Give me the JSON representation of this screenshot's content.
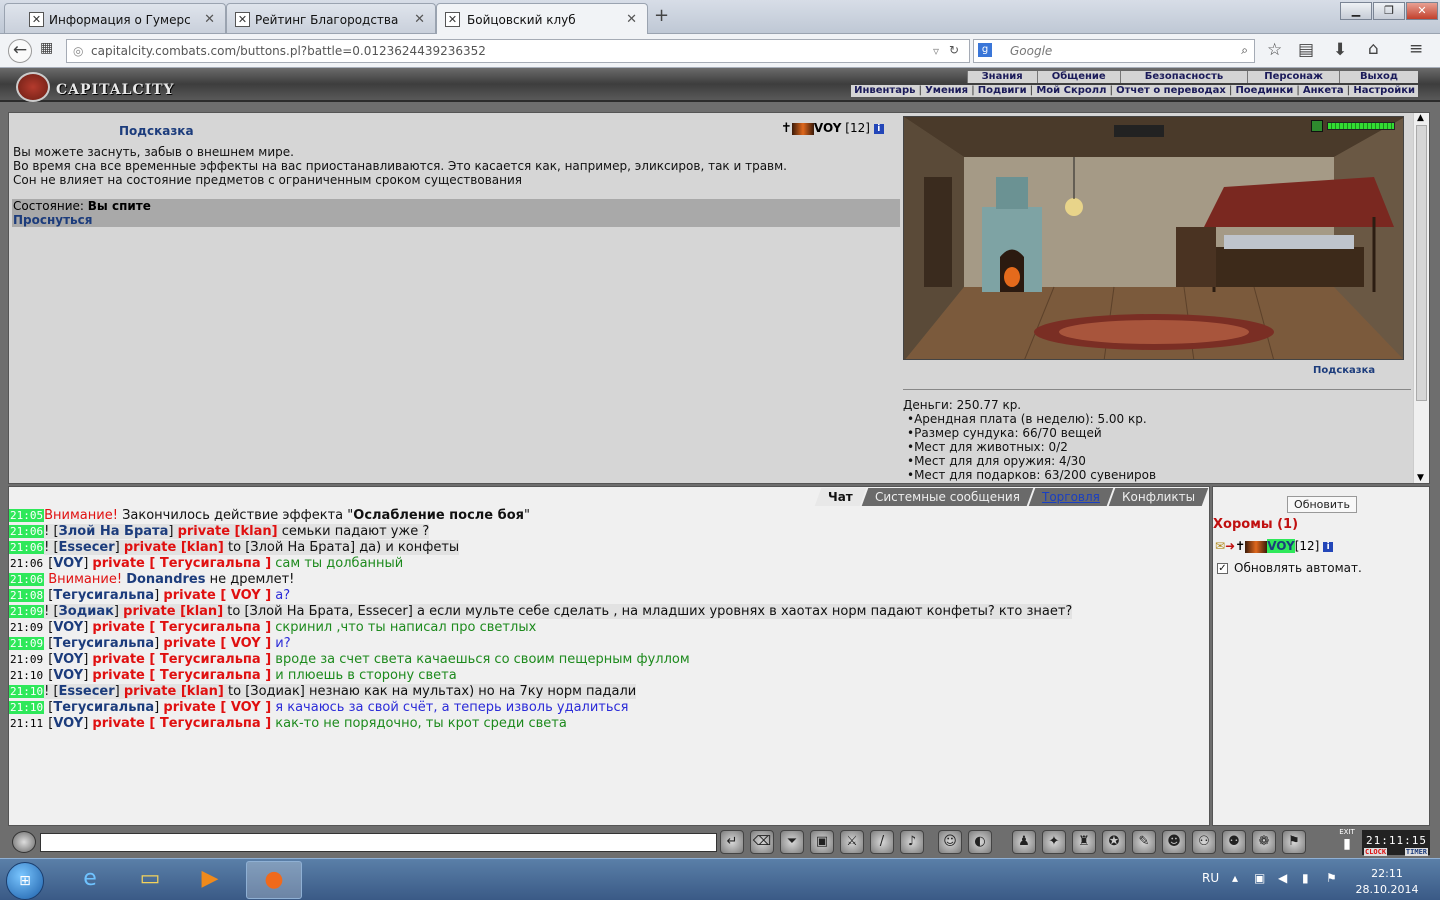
{
  "browser": {
    "tabs": [
      {
        "label": "Информация о Гумерс"
      },
      {
        "label": "Рейтинг Благородства"
      },
      {
        "label": "Бойцовский клуб"
      }
    ],
    "url": "capitalcity.combats.com/buttons.pl?battle=0.0123624439236352",
    "search_placeholder": "Google"
  },
  "game_header": {
    "logo": "CAPITALCITY",
    "top_menu": [
      "Знания",
      "Общение",
      "Безопасность",
      "Персонаж",
      "Выход"
    ],
    "sub_menu": [
      "Инвентарь",
      "Умения",
      "Подвиги",
      "Мой Скролл",
      "Отчет о переводах",
      "Поединки",
      "Анкета",
      "Настройки"
    ]
  },
  "room": {
    "hint_link": "Подсказка",
    "user": {
      "name": "VOY",
      "level": "[12]",
      "info_icon": "i"
    },
    "description": [
      "Вы можете заснуть, забыв о внешнем мире.",
      "Во время сна все временные эффекты на вас приостанавливаются. Это касается как, например, эликсиров, так и травм.",
      "Сон не влияет на состояние предметов с ограниченным сроком существования"
    ],
    "state_label": "Состояние:",
    "state_value": "Вы спите",
    "wake_link": "Проснуться",
    "hint_link_2": "Подсказка",
    "money": "Деньги: 250.77 кр.",
    "stats": [
      "Арендная плата (в неделю): 5.00 кр.",
      "Размер сундука: 66/70 вещей",
      "Мест для животных: 0/2",
      "Мест для для оружия: 4/30",
      "Мест для подарков: 63/200 сувениров"
    ]
  },
  "chat": {
    "tabs": [
      "Чат",
      "Системные сообщения",
      "Торговля",
      "Конфликты"
    ],
    "lines": [
      {
        "time": "21:05",
        "hl": true,
        "parts": [
          {
            "t": "Внимание! ",
            "c": "red"
          },
          {
            "t": "Закончилось действие эффекта \"",
            "c": "blk"
          },
          {
            "t": "Ослабление после боя",
            "c": "blkb"
          },
          {
            "t": "\"",
            "c": "blk"
          }
        ]
      },
      {
        "time": "21:06",
        "hl": true,
        "parts": [
          {
            "t": "! [",
            "c": "blk"
          },
          {
            "t": "Злой На Брата",
            "c": "nick"
          },
          {
            "t": "] ",
            "c": "blk"
          },
          {
            "t": "private [klan]",
            "c": "priv"
          },
          {
            "t": " семьки падают уже ?",
            "c": "blk"
          }
        ],
        "shade": true
      },
      {
        "time": "21:06",
        "hl": true,
        "parts": [
          {
            "t": "! [",
            "c": "blk"
          },
          {
            "t": "Essecer",
            "c": "nick"
          },
          {
            "t": "] ",
            "c": "blk"
          },
          {
            "t": "private [klan]",
            "c": "priv"
          },
          {
            "t": " to [Злой На Брата] да) и конфеты",
            "c": "blk"
          }
        ],
        "shade": true
      },
      {
        "time": "21:06",
        "hl": false,
        "parts": [
          {
            "t": " [",
            "c": "blk"
          },
          {
            "t": "VOY",
            "c": "nick"
          },
          {
            "t": "] ",
            "c": "blk"
          },
          {
            "t": "private [ Тегусигальпа ]",
            "c": "priv"
          },
          {
            "t": " сам ты долбанный",
            "c": "green"
          }
        ]
      },
      {
        "time": "21:06",
        "hl": true,
        "parts": [
          {
            "t": " Внимание! ",
            "c": "red"
          },
          {
            "t": "Donandres",
            "c": "nick"
          },
          {
            "t": " не дремлет!",
            "c": "blk"
          }
        ]
      },
      {
        "time": "21:08",
        "hl": true,
        "parts": [
          {
            "t": " [",
            "c": "blk"
          },
          {
            "t": "Тегусигальпа",
            "c": "nick"
          },
          {
            "t": "] ",
            "c": "blk"
          },
          {
            "t": "private [ VOY ]",
            "c": "priv"
          },
          {
            "t": " а?",
            "c": "blue"
          }
        ]
      },
      {
        "time": "21:09",
        "hl": true,
        "parts": [
          {
            "t": "! [",
            "c": "blk"
          },
          {
            "t": "Зодиак",
            "c": "nick"
          },
          {
            "t": "] ",
            "c": "blk"
          },
          {
            "t": "private [klan]",
            "c": "priv"
          },
          {
            "t": " to [Злой На Брата, Essecer] а если мульте себе сделать , на младших уровнях в хаотах норм падают конфеты? кто знает?",
            "c": "blk"
          }
        ],
        "shade": true
      },
      {
        "time": "21:09",
        "hl": false,
        "parts": [
          {
            "t": " [",
            "c": "blk"
          },
          {
            "t": "VOY",
            "c": "nick"
          },
          {
            "t": "] ",
            "c": "blk"
          },
          {
            "t": "private [ Тегусигальпа ]",
            "c": "priv"
          },
          {
            "t": " скринил ,что ты написал про светлых",
            "c": "green"
          }
        ]
      },
      {
        "time": "21:09",
        "hl": true,
        "parts": [
          {
            "t": " [",
            "c": "blk"
          },
          {
            "t": "Тегусигальпа",
            "c": "nick"
          },
          {
            "t": "] ",
            "c": "blk"
          },
          {
            "t": "private [ VOY ]",
            "c": "priv"
          },
          {
            "t": " и?",
            "c": "blue"
          }
        ]
      },
      {
        "time": "21:09",
        "hl": false,
        "parts": [
          {
            "t": " [",
            "c": "blk"
          },
          {
            "t": "VOY",
            "c": "nick"
          },
          {
            "t": "] ",
            "c": "blk"
          },
          {
            "t": "private [ Тегусигальпа ]",
            "c": "priv"
          },
          {
            "t": " вроде за счет света качаешься со своим пещерным фуллом",
            "c": "green"
          }
        ]
      },
      {
        "time": "21:10",
        "hl": false,
        "parts": [
          {
            "t": " [",
            "c": "blk"
          },
          {
            "t": "VOY",
            "c": "nick"
          },
          {
            "t": "] ",
            "c": "blk"
          },
          {
            "t": "private [ Тегусигальпа ]",
            "c": "priv"
          },
          {
            "t": " и плюешь в сторону света",
            "c": "green"
          }
        ]
      },
      {
        "time": "21:10",
        "hl": true,
        "parts": [
          {
            "t": "! [",
            "c": "blk"
          },
          {
            "t": "Essecer",
            "c": "nick"
          },
          {
            "t": "] ",
            "c": "blk"
          },
          {
            "t": "private [klan]",
            "c": "priv"
          },
          {
            "t": " to [Зодиак] незнаю как на мультах) но на 7ку норм падали",
            "c": "blk"
          }
        ],
        "shade": true
      },
      {
        "time": "21:10",
        "hl": true,
        "parts": [
          {
            "t": " [",
            "c": "blk"
          },
          {
            "t": "Тегусигальпа",
            "c": "nick"
          },
          {
            "t": "] ",
            "c": "blk"
          },
          {
            "t": "private [ VOY ]",
            "c": "priv"
          },
          {
            "t": " я качаюсь за свой счёт, а теперь изволь удалиться",
            "c": "blue"
          }
        ]
      },
      {
        "time": "21:11",
        "hl": false,
        "parts": [
          {
            "t": " [",
            "c": "blk"
          },
          {
            "t": "VOY",
            "c": "nick"
          },
          {
            "t": "] ",
            "c": "blk"
          },
          {
            "t": "private [ Тегусигальпа ]",
            "c": "priv"
          },
          {
            "t": " как-то не порядочно, ты крот среди света",
            "c": "green"
          }
        ]
      }
    ]
  },
  "sidebar": {
    "refresh_button": "Обновить",
    "room_title": "Хоромы (1)",
    "user_name": "VOY",
    "user_level": "[12]",
    "auto_refresh_label": "Обновлять автомат.",
    "auto_refresh_checked": "✓"
  },
  "bottom_bar": {
    "clock_digits": "21:11:15",
    "clock_label": "CLOCK",
    "timer_label": "TIMER",
    "exit_label": "EXIT"
  },
  "taskbar": {
    "lang": "RU",
    "time": "22:11",
    "date": "28.10.2014"
  },
  "colors": {
    "highlight_time": "#2ee85a",
    "private": "#e01010",
    "nick": "#1c3c7c"
  }
}
